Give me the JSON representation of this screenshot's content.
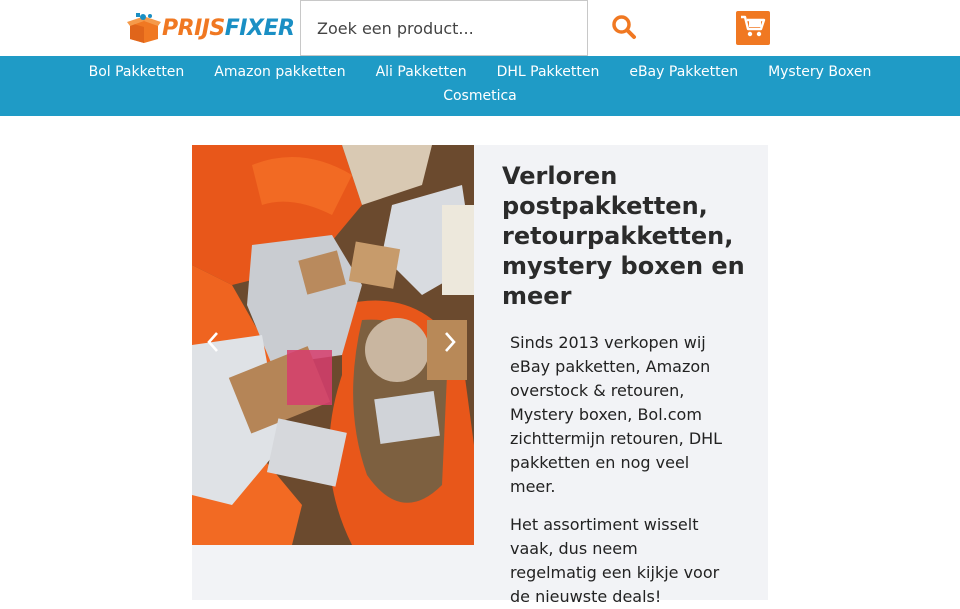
{
  "brand": {
    "logo_text_left": "PRIJS",
    "logo_text_right": "FIXER"
  },
  "search": {
    "placeholder": "Zoek een product..."
  },
  "icons": {
    "search": "search-icon",
    "cart": "cart-icon",
    "logo": "box-icon",
    "prev": "chevron-left-icon",
    "next": "chevron-right-icon"
  },
  "colors": {
    "accent": "#f07822",
    "nav_bg": "#1f9bc6",
    "hero_bg": "#f2f3f6",
    "logo_blue": "#1a8fc4"
  },
  "nav": {
    "row1": [
      "Bol Pakketten",
      "Amazon pakketten",
      "Ali Pakketten",
      "DHL Pakketten",
      "eBay Pakketten",
      "Mystery Boxen"
    ],
    "row2": [
      "Cosmetica"
    ]
  },
  "hero": {
    "title": "Verloren postpakketten, retourpakketten, mystery boxen en meer",
    "paragraph1": "Sinds 2013 verkopen wij eBay pakketten, Amazon overstock & retouren, Mystery boxen, Bol.com zichttermijn retouren, DHL pakketten en nog veel meer.",
    "paragraph2": "Het assortiment wisselt vaak, dus neem regelmatig een kijkje voor de nieuwste deals!"
  }
}
